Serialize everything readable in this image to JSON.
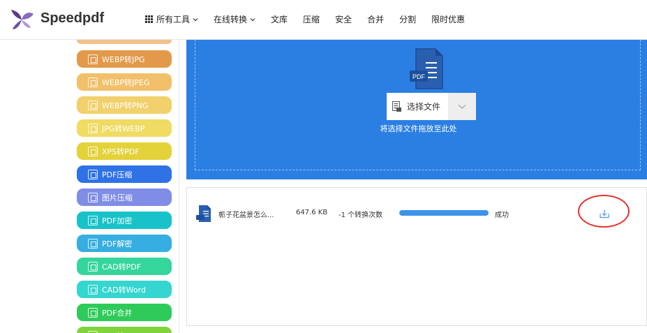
{
  "brand": {
    "name": "Speedpdf"
  },
  "nav": [
    {
      "label": "所有工具",
      "icon": "grid-icon",
      "dropdown": true
    },
    {
      "label": "在线转换",
      "dropdown": true
    },
    {
      "label": "文库"
    },
    {
      "label": "压缩"
    },
    {
      "label": "安全"
    },
    {
      "label": "合并"
    },
    {
      "label": "分割"
    },
    {
      "label": "限时优惠"
    }
  ],
  "sidebar": {
    "items": [
      {
        "label": "WEBP转JPG",
        "color": "#e29a4a"
      },
      {
        "label": "WEBP转JPEG",
        "color": "#f2c06a"
      },
      {
        "label": "WEBP转PNG",
        "color": "#f2d06b"
      },
      {
        "label": "JPG转WEBP",
        "color": "#f0db63"
      },
      {
        "label": "XPS转PDF",
        "color": "#e3d23a"
      },
      {
        "label": "PDF压缩",
        "color": "#2f72e6"
      },
      {
        "label": "图片压缩",
        "color": "#7f8de6"
      },
      {
        "label": "PDF加密",
        "color": "#17c3c9"
      },
      {
        "label": "PDF解密",
        "color": "#37aee1"
      },
      {
        "label": "CAD转PDF",
        "color": "#35d69b"
      },
      {
        "label": "CAD转Word",
        "color": "#35d6cf"
      },
      {
        "label": "PDF合并",
        "color": "#2ecb5a"
      },
      {
        "label": "XPS转Word",
        "color": "#7fd43a"
      }
    ]
  },
  "upload": {
    "choose_label": "选择文件",
    "drop_hint": "将选择文件拖放至此处",
    "pdf_badge": "PDF",
    "bg_color": "#2b7fe3"
  },
  "file": {
    "name": "栀子花盆景怎么...",
    "size": "647.6 KB",
    "count": "-1 个转换次数",
    "progress": 1.0,
    "status": "成功"
  }
}
